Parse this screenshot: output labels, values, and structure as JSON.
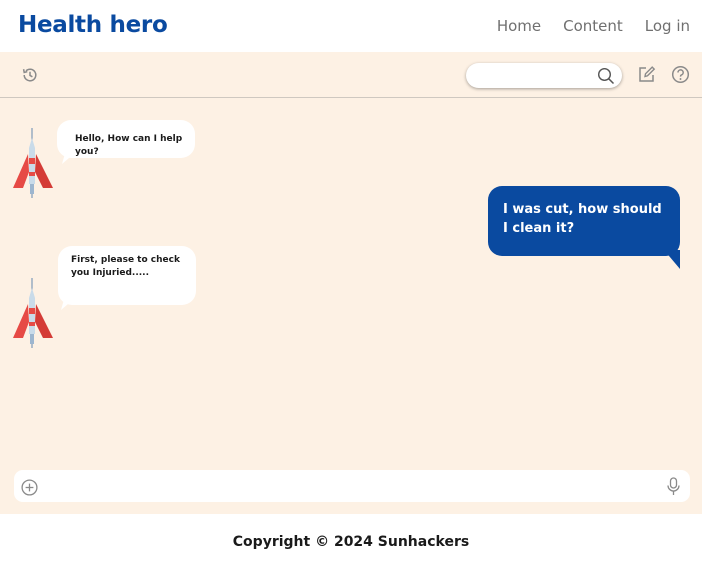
{
  "header": {
    "logo": "Health hero",
    "nav": [
      "Home",
      "Content",
      "Log in"
    ]
  },
  "toolbar": {
    "icons": [
      "history-icon",
      "search-icon",
      "edit-icon",
      "help-icon"
    ],
    "search_value": ""
  },
  "messages": [
    {
      "role": "bot",
      "text": "Hello, How can I help you?"
    },
    {
      "role": "user",
      "text": "I was cut, how should I clean it?"
    },
    {
      "role": "bot",
      "text": "First, please to check you Injuried....."
    }
  ],
  "composer": {
    "value": "",
    "icons": [
      "add-icon",
      "microphone-icon"
    ]
  },
  "footer": {
    "copyright": "Copyright © 2024 Sunhackers"
  },
  "colors": {
    "brand": "#0a4aa0",
    "chat_background": "#fdf1e4",
    "bot_bubble": "#ffffff",
    "user_bubble": "#0a4aa0"
  }
}
